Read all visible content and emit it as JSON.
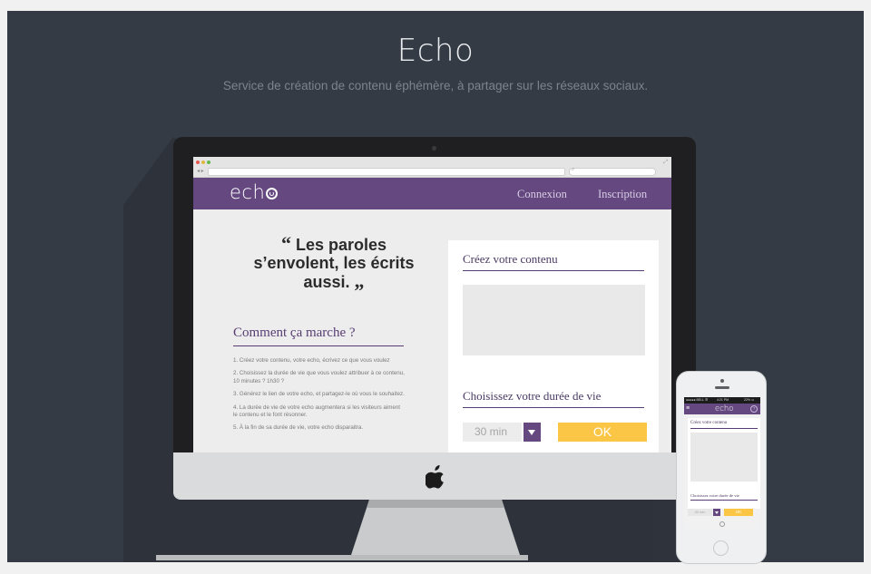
{
  "hero": {
    "title": "Echo",
    "subtitle": "Service de création de contenu éphémère, à partager sur les réseaux sociaux."
  },
  "site": {
    "logo": "ech",
    "nav": [
      {
        "label": "Connexion"
      },
      {
        "label": "Inscription"
      }
    ],
    "quote": {
      "open_mark": "“",
      "text": "Les paroles s’envolent, les écrits aussi.",
      "close_mark": "„"
    },
    "how": {
      "title": "Comment ça marche ?",
      "steps": [
        "1. Créez votre contenu, votre echo, écrivez ce que vous voulez",
        "2. Choisissez la durée de vie que vous voulez attribuer à ce contenu, 10 minutes ? 1h30 ?",
        "3. Générez le lien de votre echo, et partagez-le où vous le souhaitez.",
        "4. La durée de vie de votre echo augmentera si les visiteurs aiment le contenu et le font résonner.",
        "5. À la fin de sa durée de vie, votre echo disparaitra."
      ]
    },
    "form": {
      "create_title": "Créez votre contenu",
      "duration_title": "Choisissez votre durée de vie",
      "duration_value": "30 min",
      "ok_label": "OK"
    }
  },
  "phone": {
    "status_carrier": "●●●●● BELL ☰",
    "status_time": "4:21 PM",
    "status_battery": "22% ▭",
    "menu_icon": "≡",
    "logo": "echo",
    "help_icon": "?",
    "create_title": "Créez votre contenu",
    "duration_title": "Choisissez votre durée de vie",
    "duration_value": "30 min",
    "ok_label": "OK"
  },
  "browser": {
    "nav_arrows": "◂ ▸",
    "search_icon": "⌕",
    "expand_icon": "⤢"
  },
  "colors": {
    "stage": "#353b44",
    "purple": "#64487f",
    "yellow": "#fbc646"
  }
}
